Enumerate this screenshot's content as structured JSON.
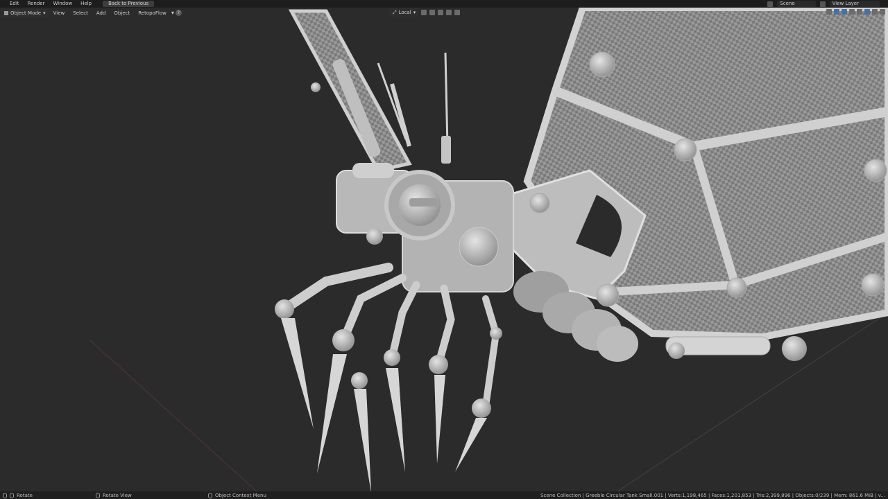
{
  "top_menu": {
    "items": [
      "Edit",
      "Render",
      "Window",
      "Help"
    ],
    "back_button": "Back to Previous",
    "scene_label": "Scene",
    "view_layer_label": "View Layer"
  },
  "viewport_header": {
    "mode": "Object Mode",
    "menus": [
      "View",
      "Select",
      "Add",
      "Object",
      "RetopoFlow"
    ],
    "help": "?",
    "transform_orientation": "Local"
  },
  "status_bar": {
    "hint_left": "Rotate",
    "hint_middle": "Rotate View",
    "hint_right": "Object Context Menu",
    "stats": "Scene Collection | Greeble Circular Tank Small.001 | Verts:1,198,465 | Faces:1,201,853 | Tris:2,399,896 | Objects:0/239 | Mem: 861.6 MiB | v..."
  },
  "colors": {
    "background": "#2b2b2b",
    "topbar": "#1d1d1d",
    "model": "#c9c9c9"
  }
}
